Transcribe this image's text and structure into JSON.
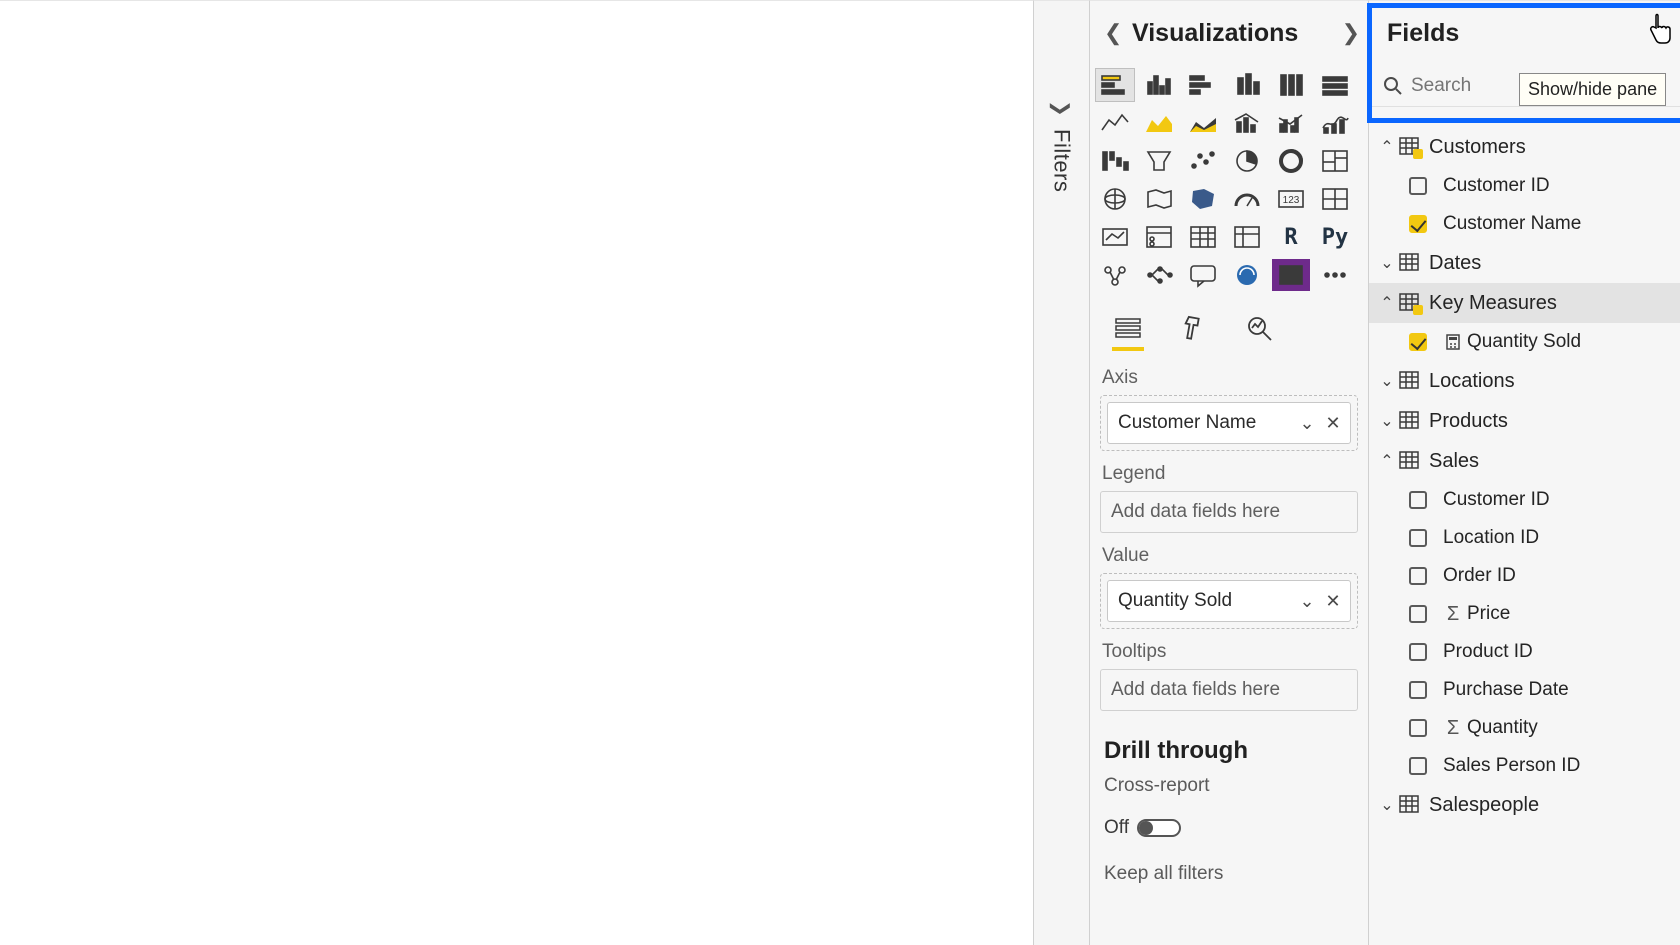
{
  "filters": {
    "label": "Filters"
  },
  "viz": {
    "title": "Visualizations",
    "icons": [
      "stacked-bar",
      "clustered-column",
      "clustered-bar",
      "stacked-column",
      "stacked-100-column",
      "stacked-100-bar",
      "line",
      "area",
      "stacked-area",
      "line-column",
      "line-clustered",
      "ribbon",
      "waterfall",
      "funnel",
      "scatter",
      "pie",
      "donut",
      "treemap",
      "map",
      "filled-map",
      "shape-map",
      "gauge",
      "card",
      "multi-card",
      "kpi",
      "slicer",
      "table",
      "matrix",
      "r",
      "py",
      "key-influencers",
      "decomposition",
      "qa",
      "paginated",
      "powerapps",
      "more"
    ],
    "tabs": [
      "fields-tab",
      "format-tab",
      "analytics-tab"
    ],
    "wells": {
      "axis": {
        "label": "Axis",
        "field": "Customer Name"
      },
      "legend": {
        "label": "Legend",
        "placeholder": "Add data fields here"
      },
      "value": {
        "label": "Value",
        "field": "Quantity Sold"
      },
      "tooltips": {
        "label": "Tooltips",
        "placeholder": "Add data fields here"
      }
    },
    "drill": {
      "title": "Drill through",
      "cross_report": "Cross-report",
      "off": "Off",
      "keep_filters": "Keep all filters"
    }
  },
  "fields": {
    "title": "Fields",
    "tooltip": "Show/hide pane",
    "search_placeholder": "Search",
    "tables": [
      {
        "name": "Customers",
        "expanded": true,
        "badge": true,
        "fields": [
          {
            "name": "Customer ID",
            "checked": false
          },
          {
            "name": "Customer Name",
            "checked": true
          }
        ]
      },
      {
        "name": "Dates",
        "expanded": false,
        "badge": false,
        "fields": []
      },
      {
        "name": "Key Measures",
        "expanded": true,
        "badge": true,
        "selected": true,
        "fields": [
          {
            "name": "Quantity Sold",
            "checked": true,
            "icon": "calc"
          }
        ]
      },
      {
        "name": "Locations",
        "expanded": false,
        "badge": false,
        "fields": []
      },
      {
        "name": "Products",
        "expanded": false,
        "badge": false,
        "fields": []
      },
      {
        "name": "Sales",
        "expanded": true,
        "badge": false,
        "fields": [
          {
            "name": "Customer ID",
            "checked": false
          },
          {
            "name": "Location ID",
            "checked": false
          },
          {
            "name": "Order ID",
            "checked": false
          },
          {
            "name": "Price",
            "checked": false,
            "icon": "sigma"
          },
          {
            "name": "Product ID",
            "checked": false
          },
          {
            "name": "Purchase Date",
            "checked": false
          },
          {
            "name": "Quantity",
            "checked": false,
            "icon": "sigma"
          },
          {
            "name": "Sales Person ID",
            "checked": false
          }
        ]
      },
      {
        "name": "Salespeople",
        "expanded": false,
        "badge": false,
        "fields": []
      }
    ]
  }
}
